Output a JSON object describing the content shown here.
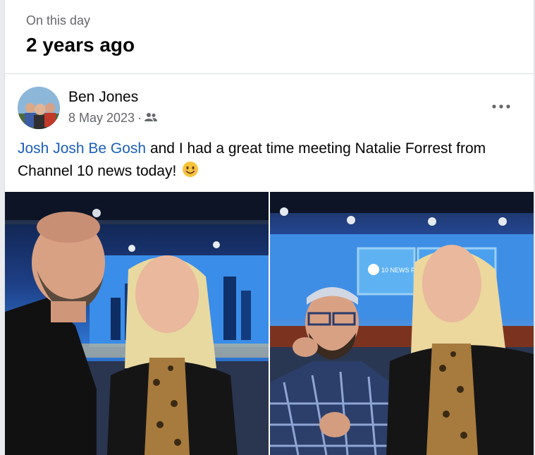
{
  "memory": {
    "label": "On this day",
    "title": "2 years ago"
  },
  "post": {
    "author": "Ben Jones",
    "date": "8 May 2023",
    "separator": "·",
    "audience_icon": "friends-icon",
    "more_icon": "more-options-icon",
    "mention": "Josh Josh Be Gosh",
    "text_line1_rest": " and I had a great time meeting Natalie Forrest from",
    "text_line2": "Channel 10 news today!",
    "emoji": "smiling-face-icon"
  },
  "photos": [
    {
      "name": "studio-selfie-photo-1",
      "studio_sign": ""
    },
    {
      "name": "studio-selfie-photo-2",
      "studio_sign": "10 NEWS FIRST"
    }
  ],
  "colors": {
    "link": "#1b5fb8",
    "secondary_text": "#65676b",
    "primary_text": "#050505"
  }
}
